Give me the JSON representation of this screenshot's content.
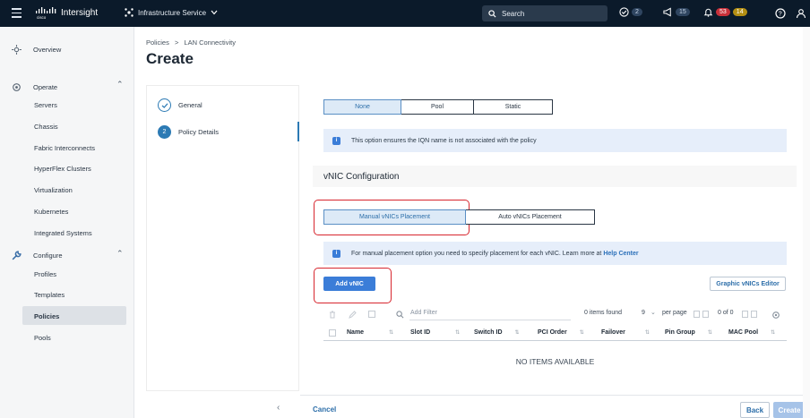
{
  "topbar": {
    "brand": "Intersight",
    "service": "Infrastructure Service",
    "search_label": "Search",
    "badge_tasks": "2",
    "badge_announcements": "15",
    "badge_critical": "53",
    "badge_warning": "14"
  },
  "sidebar": {
    "overview": "Overview",
    "operate": "Operate",
    "operate_items": [
      "Servers",
      "Chassis",
      "Fabric Interconnects",
      "HyperFlex Clusters",
      "Virtualization",
      "Kubernetes",
      "Integrated Systems"
    ],
    "configure": "Configure",
    "configure_items": [
      "Profiles",
      "Templates",
      "Policies",
      "Pools"
    ]
  },
  "breadcrumb": {
    "root": "Policies",
    "sep": ">",
    "current": "LAN Connectivity"
  },
  "page_title": "Create",
  "steps": [
    {
      "num": "",
      "label": "General"
    },
    {
      "num": "2",
      "label": "Policy Details"
    }
  ],
  "iqn": {
    "options": [
      "None",
      "Pool",
      "Static"
    ],
    "selected": "None",
    "info": "This option ensures the IQN name is not associated with the policy"
  },
  "vnic": {
    "section_title": "vNIC Configuration",
    "placement_options": [
      "Manual vNICs Placement",
      "Auto vNICs Placement"
    ],
    "selected": "Manual vNICs Placement",
    "info_text": "For manual placement option you need to specify placement for each vNIC. Learn more at ",
    "info_link": "Help Center",
    "add_button": "Add vNIC",
    "editor_button": "Graphic vNICs Editor"
  },
  "table": {
    "filter_placeholder": "Add Filter",
    "items_found": "0 items found",
    "per_page_value": "9",
    "per_page_label": "per page",
    "page_info": "0 of 0",
    "columns": [
      "Name",
      "Slot ID",
      "Switch ID",
      "PCI Order",
      "Failover",
      "Pin Group",
      "MAC Pool"
    ],
    "empty": "NO ITEMS AVAILABLE"
  },
  "footer": {
    "cancel": "Cancel",
    "back": "Back",
    "create": "Create"
  },
  "colors": {
    "accent": "#3b7dd8",
    "highlight": "#d7262e",
    "topbar": "#0b1a2a"
  }
}
